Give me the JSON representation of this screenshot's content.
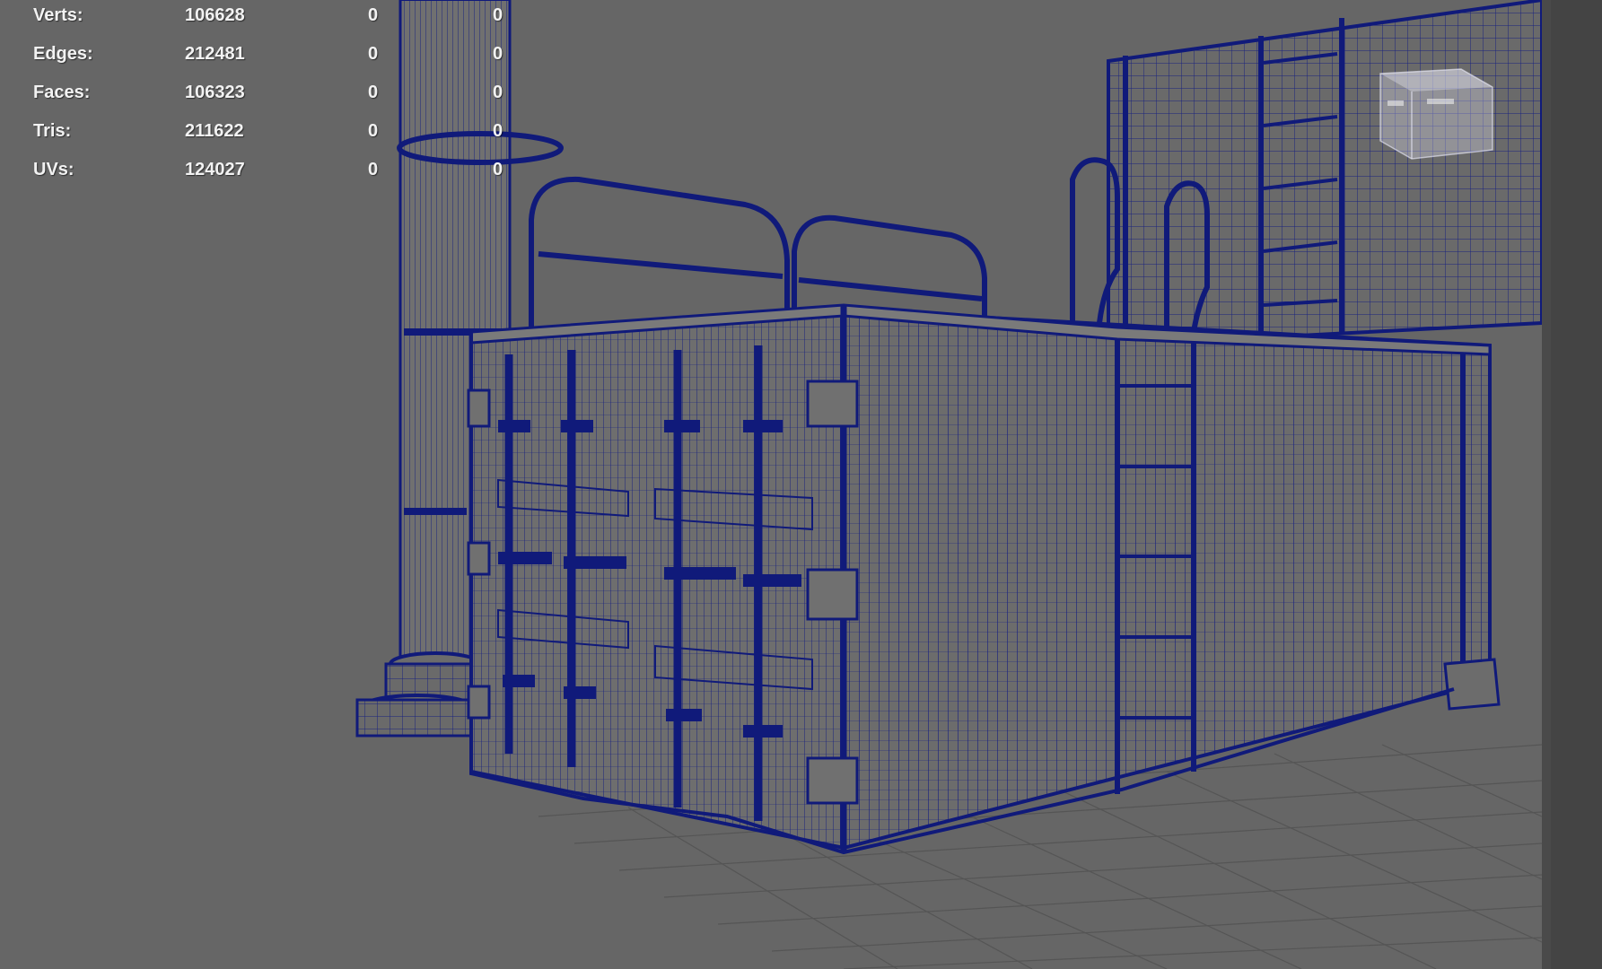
{
  "poly_count": {
    "rows": [
      {
        "label": "Verts:",
        "total": "106628",
        "selected": "0",
        "component": "0"
      },
      {
        "label": "Edges:",
        "total": "212481",
        "selected": "0",
        "component": "0"
      },
      {
        "label": "Faces:",
        "total": "106323",
        "selected": "0",
        "component": "0"
      },
      {
        "label": "Tris:",
        "total": "211622",
        "selected": "0",
        "component": "0"
      },
      {
        "label": "UVs:",
        "total": "124027",
        "selected": "0",
        "component": "0"
      }
    ]
  },
  "viewport": {
    "background_color": "#666666",
    "wire_color": "#101a7a",
    "grid_color": "#555555",
    "view_cube_icon": "view-cube-icon"
  }
}
